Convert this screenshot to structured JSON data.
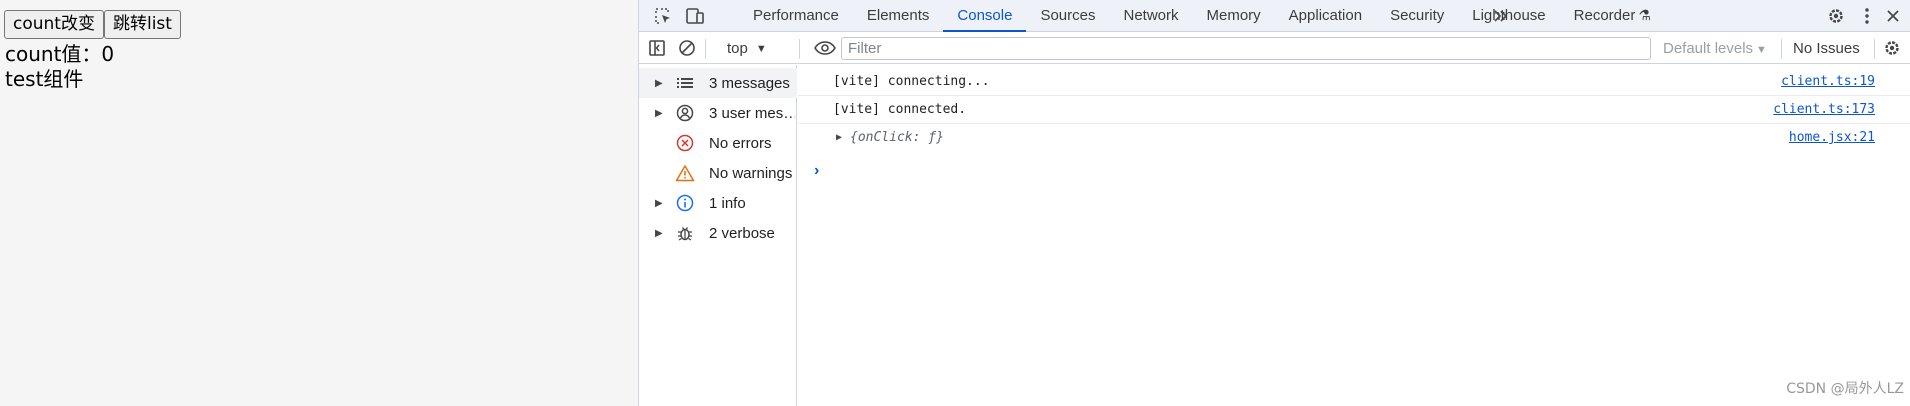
{
  "app": {
    "count_button": "count改变",
    "jump_button": "跳转list",
    "count_text": "count值：0",
    "test_text": "test组件"
  },
  "devtools": {
    "icons": {
      "inspect": "inspect-element-icon",
      "device": "device-toolbar-icon",
      "more_tabs": "chevron-double-right-icon",
      "settings": "gear-icon",
      "menu": "more-vertical-icon",
      "close": "close-icon",
      "recorder": "flask-icon"
    },
    "tabs": [
      {
        "label": "Performance",
        "active": false
      },
      {
        "label": "Elements",
        "active": false
      },
      {
        "label": "Console",
        "active": true
      },
      {
        "label": "Sources",
        "active": false
      },
      {
        "label": "Network",
        "active": false
      },
      {
        "label": "Memory",
        "active": false
      },
      {
        "label": "Application",
        "active": false
      },
      {
        "label": "Security",
        "active": false
      },
      {
        "label": "Lighthouse",
        "active": false
      },
      {
        "label": "Recorder",
        "active": false
      }
    ],
    "toolbar": {
      "context": "top",
      "filter_placeholder": "Filter",
      "filter_value": "",
      "levels": "Default levels",
      "issues": "No Issues"
    },
    "sidebar": [
      {
        "label": "3 messages",
        "icon": "list-icon",
        "expandable": true,
        "selected": true
      },
      {
        "label": "3 user mes…",
        "icon": "user-icon",
        "expandable": true,
        "selected": false
      },
      {
        "label": "No errors",
        "icon": "error-icon",
        "expandable": false,
        "selected": false
      },
      {
        "label": "No warnings",
        "icon": "warning-icon",
        "expandable": false,
        "selected": false
      },
      {
        "label": "1 info",
        "icon": "info-icon",
        "expandable": true,
        "selected": false
      },
      {
        "label": "2 verbose",
        "icon": "bug-icon",
        "expandable": true,
        "selected": false
      }
    ],
    "messages": [
      {
        "text": "[vite] connecting...",
        "source": "client.ts:19"
      },
      {
        "text": "[vite] connected.",
        "source": "client.ts:173"
      },
      {
        "text": "{onClick: ƒ}",
        "source": "home.jsx:21"
      }
    ],
    "colors": {
      "accent": "#0b57d0",
      "error": "#dc362e",
      "warning": "#e8710a",
      "info": "#1a73e8"
    }
  },
  "watermark": "CSDN @局外人LZ"
}
